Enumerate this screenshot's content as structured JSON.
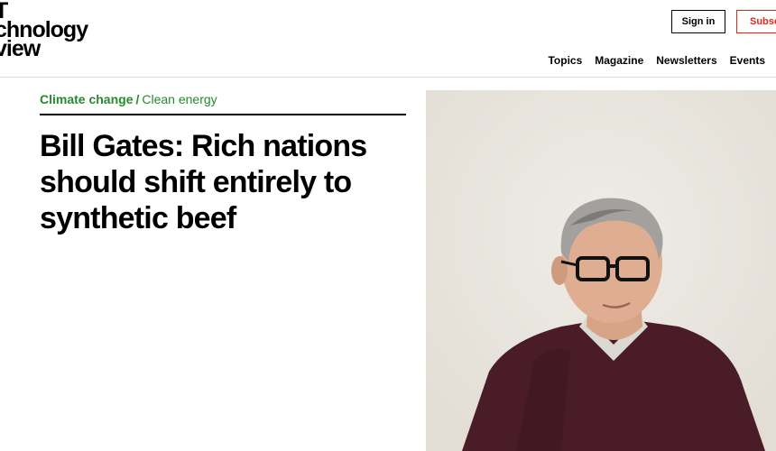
{
  "header": {
    "logo_lines": [
      "T",
      "chnology",
      "view"
    ],
    "sign_in_label": "Sign in",
    "subscribe_label": "Subsc",
    "nav": [
      "Topics",
      "Magazine",
      "Newsletters",
      "Events"
    ]
  },
  "article": {
    "breadcrumb": {
      "category": "Climate change",
      "separator": "/",
      "subcategory": "Clean energy"
    },
    "headline": "Bill Gates: Rich nations should shift entirely to synthetic beef"
  },
  "colors": {
    "accent_green": "#258a2b",
    "subscribe_red": "#e0281b",
    "photo_background": "#e9e6df",
    "sweater": "#4a1c28"
  },
  "icons": [
    "logo-icon"
  ]
}
